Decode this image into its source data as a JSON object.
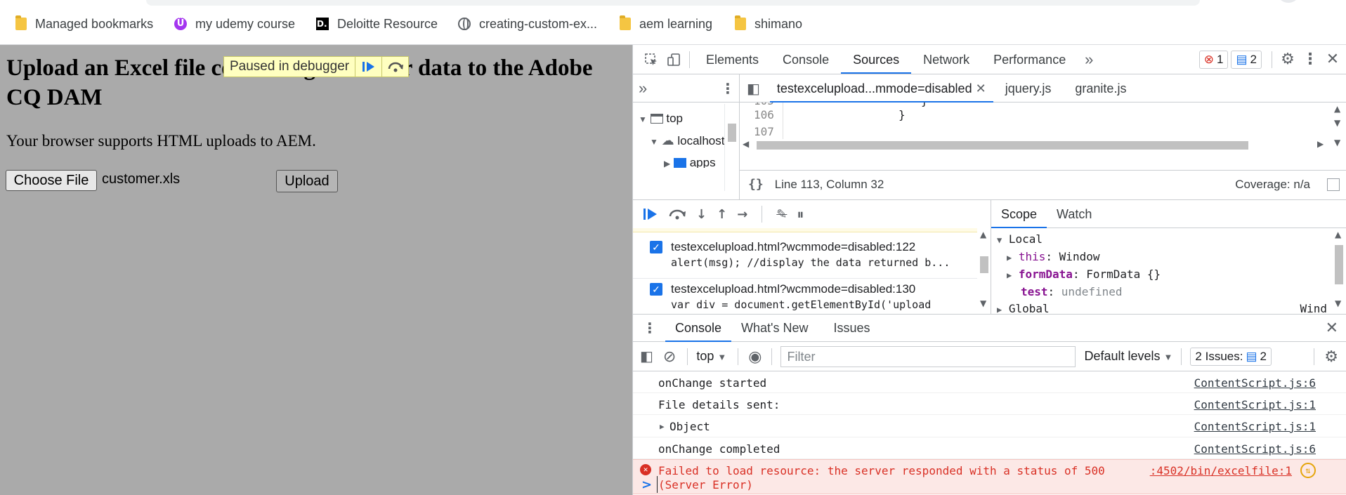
{
  "bookmarks": [
    {
      "label": "Managed bookmarks",
      "icon": "folder-icon"
    },
    {
      "label": "my udemy course",
      "icon": "udemy-icon"
    },
    {
      "label": "Deloitte Resource",
      "icon": "deloitte-icon"
    },
    {
      "label": "creating-custom-ex...",
      "icon": "globe-icon"
    },
    {
      "label": "aem learning",
      "icon": "folder-icon"
    },
    {
      "label": "shimano",
      "icon": "folder-icon"
    }
  ],
  "page": {
    "heading": "Upload an Excel file containing customer data to the Adobe CQ DAM",
    "paused_label": "Paused in debugger",
    "description": "Your browser supports HTML uploads to AEM.",
    "choose_label": "Choose File",
    "file_name": "customer.xls",
    "upload_label": "Upload"
  },
  "devtools": {
    "tabs": [
      "Elements",
      "Console",
      "Sources",
      "Network",
      "Performance"
    ],
    "active_tab": "Sources",
    "errors_count": "1",
    "messages_count": "2",
    "nav_tree": [
      "top",
      "localhost",
      "apps"
    ],
    "file_tabs": [
      "testexcelupload...mmode=disabled",
      "jquery.js",
      "granite.js"
    ],
    "code_lines": [
      {
        "num": "106",
        "text": "}"
      },
      {
        "num": "107",
        "text": ""
      }
    ],
    "status_position": "Line 113, Column 32",
    "coverage": "Coverage: n/a",
    "breakpoints": [
      {
        "file": "testexcelupload.html?wcmmode=disabled:122",
        "code": "alert(msg); //display the data returned b..."
      },
      {
        "file": "testexcelupload.html?wcmmode=disabled:130",
        "code": "var div = document.getElementById('upload"
      }
    ],
    "scope_tabs": [
      "Scope",
      "Watch"
    ],
    "scope_section": "Local",
    "scope_vars": [
      {
        "name": "this",
        "value": "Window",
        "expandable": true
      },
      {
        "name": "formData",
        "value": "FormData {}",
        "expandable": true
      },
      {
        "name": "test",
        "value": "undefined",
        "expandable": false
      }
    ],
    "scope_cut": "Global",
    "scope_cut_right": "Wind",
    "drawer_tabs": [
      "Console",
      "What's New",
      "Issues"
    ],
    "context": "top",
    "filter_placeholder": "Filter",
    "levels": "Default levels",
    "issues_label": "2 Issues:",
    "issues_count": "2",
    "messages": [
      {
        "text": "onChange started",
        "source": "ContentScript.js:6"
      },
      {
        "text": "File details sent:",
        "source": "ContentScript.js:1"
      },
      {
        "text": "Object",
        "source": "ContentScript.js:1",
        "expandable": true
      },
      {
        "text": "onChange completed",
        "source": "ContentScript.js:6"
      }
    ],
    "error": {
      "line1": "Failed to load resource: the server responded with a status of 500",
      "line2": "(Server Error)",
      "source": ":4502/bin/excelfile:1"
    },
    "prompt": ">"
  },
  "colors": {
    "accent": "#1a73e8",
    "error": "#d93025",
    "page_overlay": "#aaaaaa",
    "pause_bg": "#ffffc0"
  }
}
